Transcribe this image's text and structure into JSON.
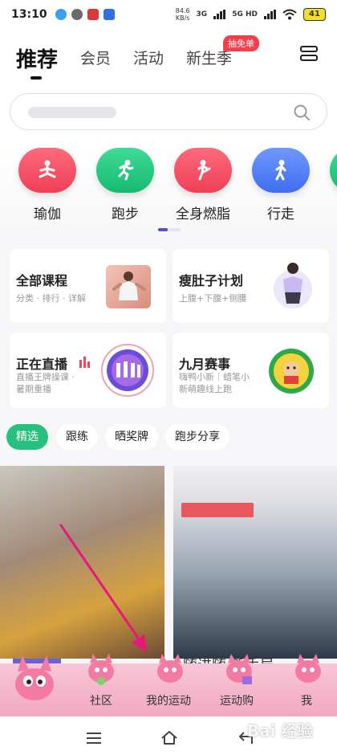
{
  "status_bar": {
    "time": "13:10",
    "speed": "84.6",
    "speed_unit": "KB/s",
    "network_1": "3G",
    "network_2": "5G HD",
    "battery": "41"
  },
  "header": {
    "tabs": [
      {
        "label": "推荐",
        "active": true
      },
      {
        "label": "会员"
      },
      {
        "label": "活动"
      },
      {
        "label": "新生季"
      }
    ],
    "badge": "抽免单",
    "menu_icon": "layout-icon"
  },
  "search": {
    "placeholder": "",
    "icon": "search-icon"
  },
  "categories": [
    {
      "label": "瑜伽",
      "color": "#f0465a",
      "icon": "yoga-icon"
    },
    {
      "label": "跑步",
      "color": "#1fc87f",
      "icon": "running-icon"
    },
    {
      "label": "全身燃脂",
      "color": "#f0465a",
      "icon": "kick-icon"
    },
    {
      "label": "行走",
      "color": "#4f7ef2",
      "icon": "walking-icon"
    }
  ],
  "cards": [
    {
      "title": "全部课程",
      "subtitle": "分类 · 排行 · 详解"
    },
    {
      "title": "瘦肚子计划",
      "subtitle": "上腹+下腹+侧腰"
    },
    {
      "title": "正在直播",
      "subtitle_1": "直播王牌操课 ·",
      "subtitle_2": "暑期重播"
    },
    {
      "title": "九月赛事",
      "subtitle_1": "嗨鸭小新｜蜡笔小",
      "subtitle_2": "新萌趣线上跑"
    }
  ],
  "chips": [
    {
      "label": "精选",
      "active": true
    },
    {
      "label": "跟练"
    },
    {
      "label": "晒奖牌"
    },
    {
      "label": "跑步分享"
    }
  ],
  "feed": {
    "right_caption": "随进随 新手局"
  },
  "bottom_nav": [
    {
      "label": "社区"
    },
    {
      "label": "我的运动"
    },
    {
      "label": "运动购"
    },
    {
      "label": "我"
    }
  ],
  "watermark": "Bai 经验",
  "colors": {
    "accent_green": "#27c07e",
    "badge_red": "#f0404e",
    "nav_pink": "#f4b6cc",
    "arrow": "#e6197a"
  }
}
